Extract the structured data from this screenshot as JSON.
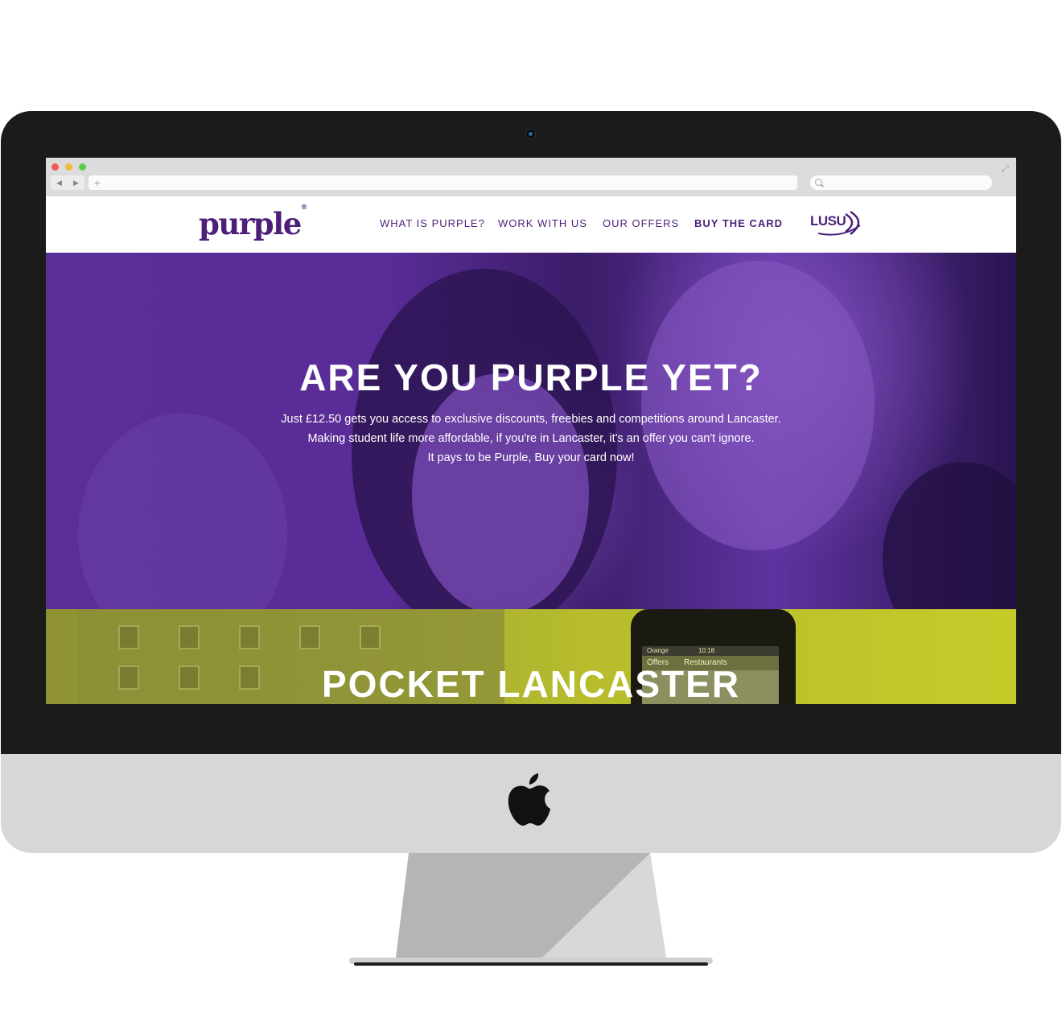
{
  "browser": {
    "back_glyph": "◀",
    "forward_glyph": "▶",
    "new_tab_glyph": "+",
    "expand_glyph": "⤢",
    "dots": [
      "close",
      "minimize",
      "zoom"
    ]
  },
  "site": {
    "logo": "purple",
    "logo_mark": "®",
    "nav": [
      {
        "label": "WHAT IS PURPLE?"
      },
      {
        "label": "WORK WITH US"
      },
      {
        "label": "OUR OFFERS"
      },
      {
        "label": "BUY THE CARD"
      }
    ],
    "partner_logo": "LUSU"
  },
  "hero": {
    "title": "ARE YOU PURPLE YET?",
    "lines": [
      "Just £12.50 gets you access to exclusive discounts, freebies and competitions around Lancaster.",
      "Making student life more affordable, if you're in Lancaster, it's an offer you can't ignore.",
      "It pays to be Purple, Buy your card now!"
    ]
  },
  "pocket": {
    "title": "POCKET LANCASTER",
    "phone_carrier": "Orange",
    "phone_time": "10:18",
    "phone_tab": "Offers",
    "phone_heading": "Restaurants"
  },
  "colors": {
    "brand_purple": "#4c1f7a",
    "hero_purple": "#5b2d98",
    "pocket_lime": "#b6bc2c",
    "bezel": "#1b1b1b",
    "aluminium": "#d6d7d9"
  },
  "icons": [
    "camera-icon",
    "apple-logo-icon",
    "search-icon",
    "expand-icon"
  ]
}
